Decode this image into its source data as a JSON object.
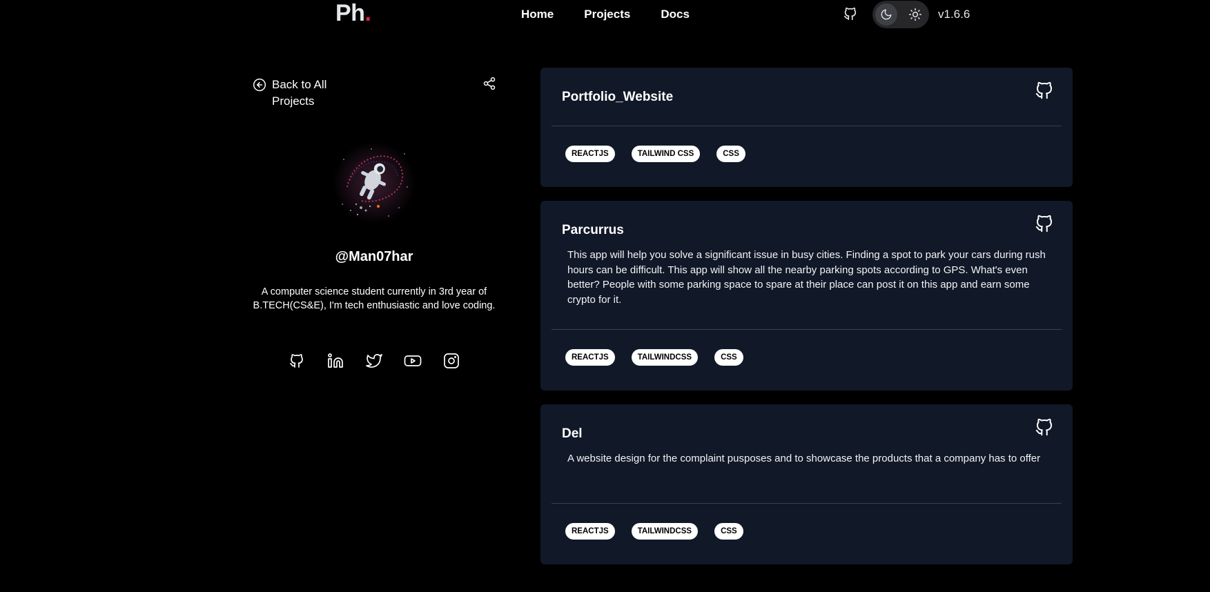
{
  "header": {
    "logo_text": "Ph",
    "logo_dot": ".",
    "nav": [
      "Home",
      "Projects",
      "Docs"
    ],
    "version": "v1.6.6"
  },
  "profile": {
    "back_label": "Back to All Projects",
    "username": "@Man07har",
    "bio": "A computer science student currently in 3rd year of B.TECH(CS&E), I'm tech enthusiastic and love coding.",
    "socials": [
      "github-icon",
      "linkedin-icon",
      "twitter-icon",
      "youtube-icon",
      "instagram-icon"
    ]
  },
  "projects": [
    {
      "title": "Portfolio_Website",
      "description": "",
      "tags": [
        "REACTJS",
        "TAILWIND CSS",
        "CSS"
      ]
    },
    {
      "title": "Parcurrus",
      "description": "This app will help you solve a significant issue in busy cities. Finding a spot to park your cars during rush hours can be difficult. This app will show all the nearby parking spots according to GPS. What's even better? People with some parking space to spare at their place can post it on this app and earn some crypto for it.",
      "tags": [
        "REACTJS",
        "TAILWINDCSS",
        "CSS"
      ]
    },
    {
      "title": "Del",
      "description": "A website design for the complaint pusposes and to showcase the products that a company has to offer",
      "tags": [
        "REACTJS",
        "TAILWINDCSS",
        "CSS"
      ]
    }
  ],
  "colors": {
    "background": "#000000",
    "card": "#111827",
    "accent_dot": "#e11d48"
  }
}
